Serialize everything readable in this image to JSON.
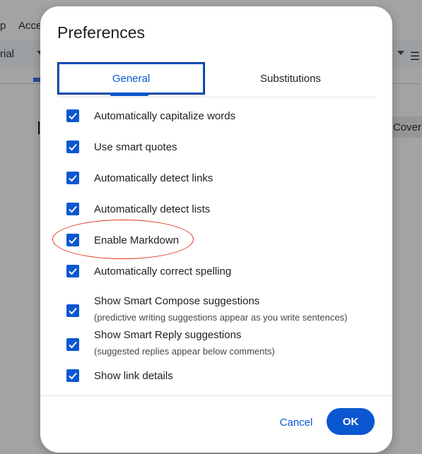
{
  "background": {
    "menu_items": [
      "p",
      "Acce"
    ],
    "font_name": "rial",
    "cover_label": "Cover"
  },
  "dialog": {
    "title": "Preferences",
    "tabs": [
      {
        "label": "General",
        "selected": true
      },
      {
        "label": "Substitutions",
        "selected": false
      }
    ],
    "options": [
      {
        "label": "Automatically capitalize words",
        "checked": true
      },
      {
        "label": "Use smart quotes",
        "checked": true
      },
      {
        "label": "Automatically detect links",
        "checked": true
      },
      {
        "label": "Automatically detect lists",
        "checked": true
      },
      {
        "label": "Enable Markdown",
        "checked": true
      },
      {
        "label": "Automatically correct spelling",
        "checked": true
      },
      {
        "label": "Show Smart Compose suggestions",
        "sublabel": "(predictive writing suggestions appear as you write sentences)",
        "checked": true
      },
      {
        "label": "Show Smart Reply suggestions",
        "sublabel": "(suggested replies appear below comments)",
        "checked": true
      },
      {
        "label": "Show link details",
        "checked": true
      }
    ],
    "buttons": {
      "cancel": "Cancel",
      "ok": "OK"
    }
  },
  "colors": {
    "accent": "#0b57d0",
    "highlight_annotation": "#e0341d",
    "backdrop": "#a3a3a3"
  }
}
